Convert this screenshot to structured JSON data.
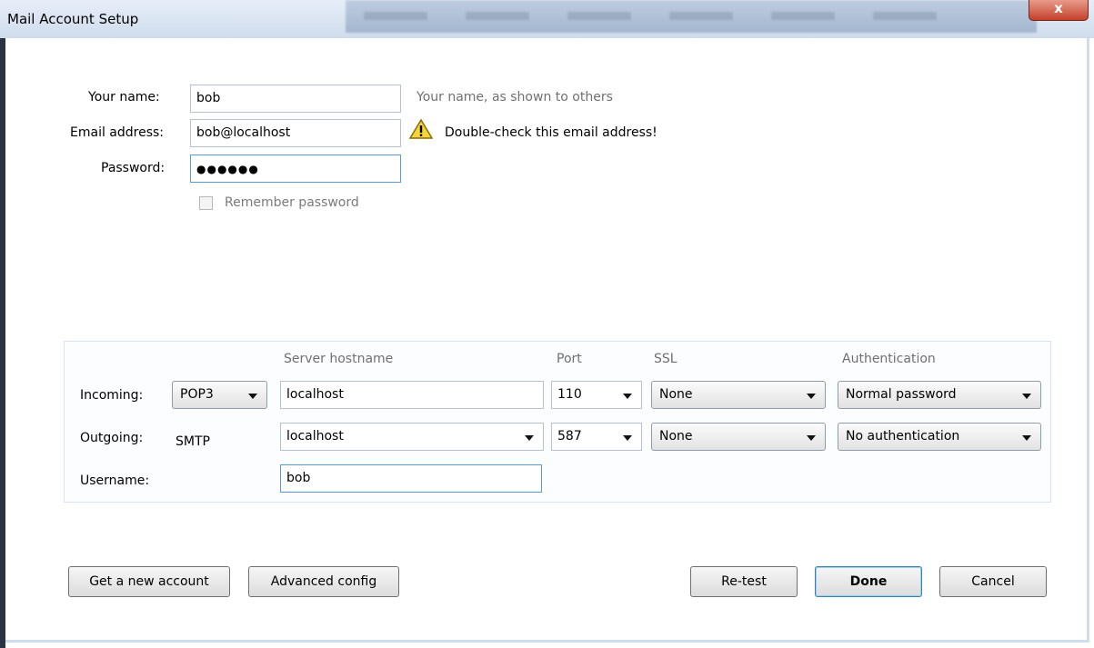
{
  "window": {
    "title": "Mail Account Setup",
    "close_glyph": "x"
  },
  "identity": {
    "name_label": "Your name:",
    "name_value": "bob",
    "name_hint": "Your name, as shown to others",
    "email_label": "Email address:",
    "email_value": "bob@localhost",
    "email_warning": "Double-check this email address!",
    "password_label": "Password:",
    "password_value": "●●●●●●",
    "remember_label": "Remember password",
    "remember_checked": false
  },
  "server": {
    "headers": {
      "hostname": "Server hostname",
      "port": "Port",
      "ssl": "SSL",
      "auth": "Authentication"
    },
    "incoming": {
      "label": "Incoming:",
      "protocol": "POP3",
      "hostname": "localhost",
      "port": "110",
      "ssl": "None",
      "auth": "Normal password"
    },
    "outgoing": {
      "label": "Outgoing:",
      "protocol": "SMTP",
      "hostname": "localhost",
      "port": "587",
      "ssl": "None",
      "auth": "No authentication"
    },
    "username": {
      "label": "Username:",
      "value": "bob"
    }
  },
  "buttons": {
    "new_account": "Get a new account",
    "advanced": "Advanced config",
    "retest": "Re-test",
    "done": "Done",
    "cancel": "Cancel"
  },
  "icons": {
    "warning": "warning-triangle-icon",
    "close": "close-icon",
    "dropdown": "chevron-down-icon"
  },
  "colors": {
    "titlebar": "#cfdcec",
    "focus_border": "#5b9bd5",
    "close_button": "#c4412b",
    "warning_fill": "#f5d33b"
  }
}
